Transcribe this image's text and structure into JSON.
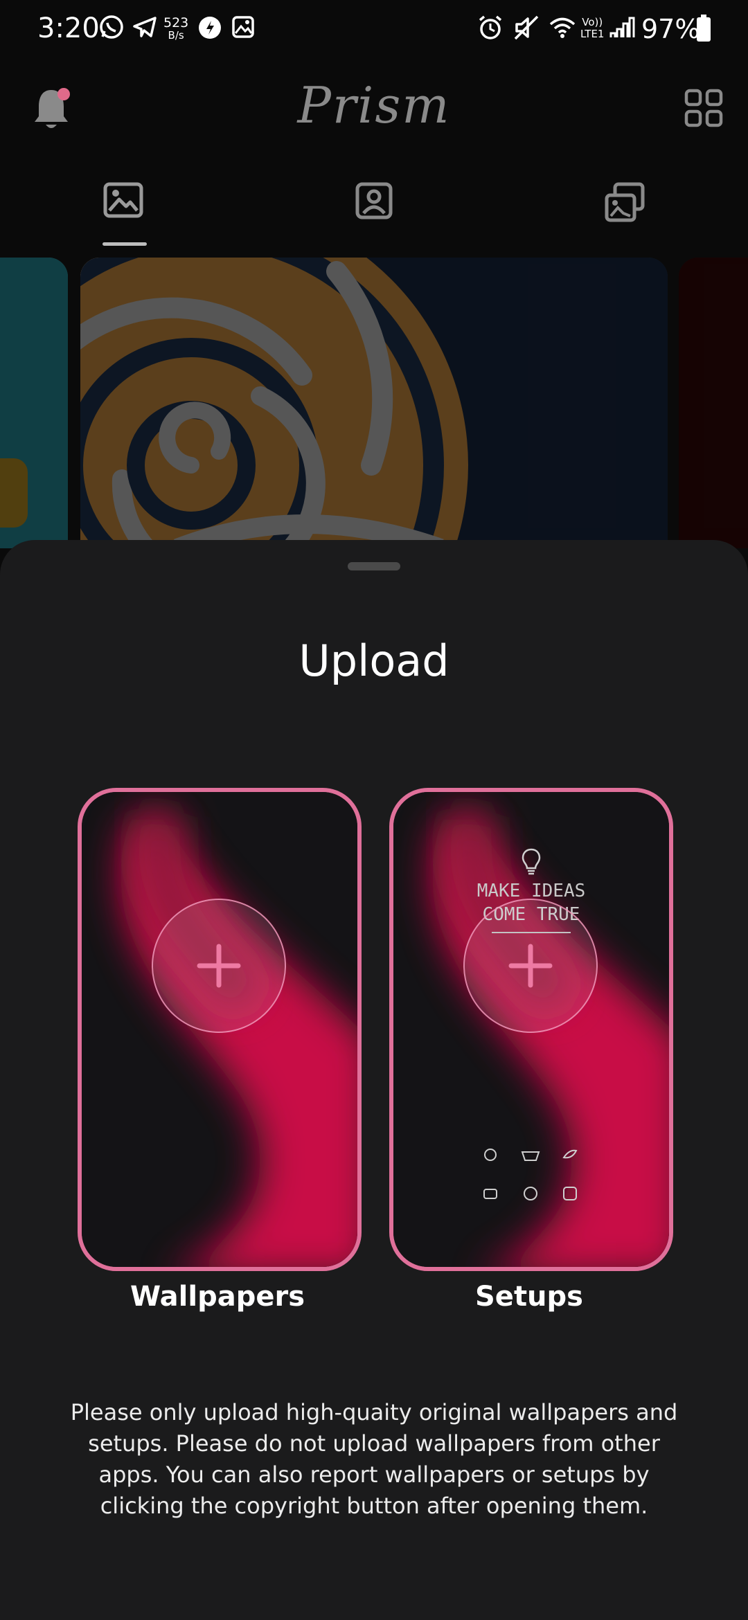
{
  "status_bar": {
    "time": "3:20",
    "net_speed_value": "523",
    "net_speed_unit": "B/s",
    "volte_top": "Vo))",
    "volte_bottom": "LTE1",
    "battery": "97%",
    "icons": [
      "whatsapp-icon",
      "telegram-icon",
      "net-speed",
      "app-icon",
      "gallery-icon",
      "alarm-icon",
      "mute-icon",
      "wifi-icon",
      "volte-icon",
      "signal-icon",
      "battery-icon"
    ]
  },
  "header": {
    "title": "Prism",
    "notification_badge_color": "#e06a8a",
    "tabs": [
      {
        "name": "wallpapers-tab",
        "icon": "image-icon"
      },
      {
        "name": "profile-tab",
        "icon": "profile-icon"
      },
      {
        "name": "setups-tab",
        "icon": "collections-icon"
      }
    ],
    "selected_tab": 0
  },
  "sheet": {
    "title": "Upload",
    "options": [
      {
        "label": "Wallpapers",
        "icon": "plus-icon"
      },
      {
        "label": "Setups",
        "icon": "plus-icon",
        "preview_text_1": "MAKE IDEAS",
        "preview_text_2": "COME TRUE"
      }
    ],
    "accent_color": "#e0709a",
    "notice": "Please only upload high-quaity original wallpapers and setups. Please do not upload wallpapers from other apps. You can also report wallpapers or setups by clicking the copyright button after opening them."
  }
}
